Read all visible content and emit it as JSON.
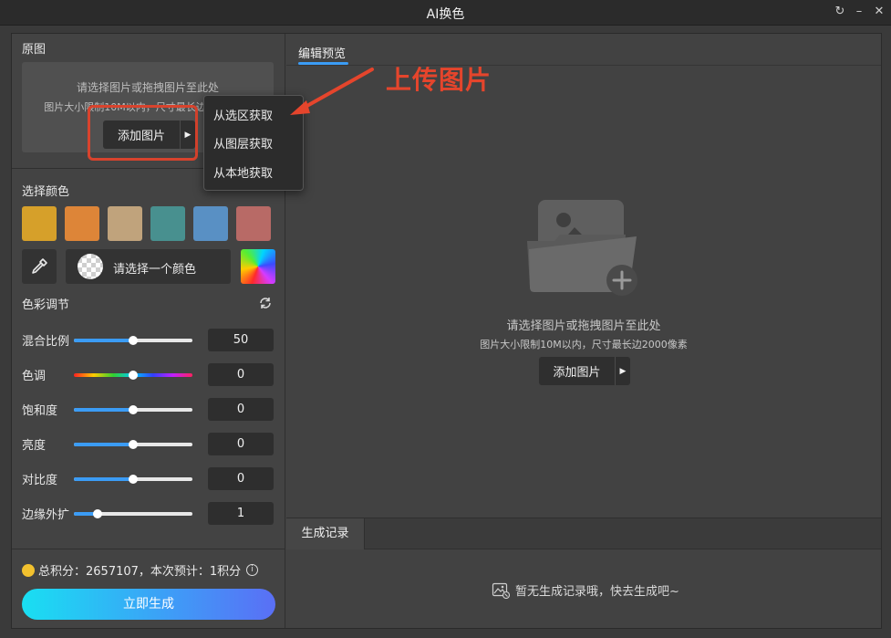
{
  "window": {
    "title": "AI换色"
  },
  "left": {
    "original": {
      "section_title": "原图",
      "hint_line1": "请选择图片或拖拽图片至此处",
      "hint_line2": "图片大小限制10M以内，尺寸最长边2000像素",
      "add_button_label": "添加图片"
    },
    "dropdown": {
      "items": [
        "从选区获取",
        "从图层获取",
        "从本地获取"
      ]
    },
    "color": {
      "section_title": "选择颜色",
      "swatches": [
        "#d6a02a",
        "#dd8538",
        "#c0a37c",
        "#48908f",
        "#5990c4",
        "#b86a66"
      ],
      "picker_label": "请选择一个颜色"
    },
    "adjust": {
      "section_title": "色彩调节",
      "rows": [
        {
          "label": "混合比例",
          "value": "50",
          "fraction": 0.5
        },
        {
          "label": "色调",
          "value": "0",
          "fraction": 0.5
        },
        {
          "label": "饱和度",
          "value": "0",
          "fraction": 0.5
        },
        {
          "label": "亮度",
          "value": "0",
          "fraction": 0.5
        },
        {
          "label": "对比度",
          "value": "0",
          "fraction": 0.5
        },
        {
          "label": "边缘外扩",
          "value": "1",
          "fraction": 0.2
        }
      ]
    },
    "points_text": "总积分：2657107，本次预计：1积分",
    "generate_label": "立即生成"
  },
  "right": {
    "tab_label": "编辑预览",
    "empty_line1": "请选择图片或拖拽图片至此处",
    "empty_line2": "图片大小限制10M以内，尺寸最长边2000像素",
    "add_button_label": "添加图片",
    "history_tab_label": "生成记录",
    "history_empty": "暂无生成记录哦，快去生成吧~"
  },
  "annotation": {
    "text": "上传图片",
    "color": "#e5452c"
  },
  "colors": {
    "accent": "#3b9cf5"
  }
}
